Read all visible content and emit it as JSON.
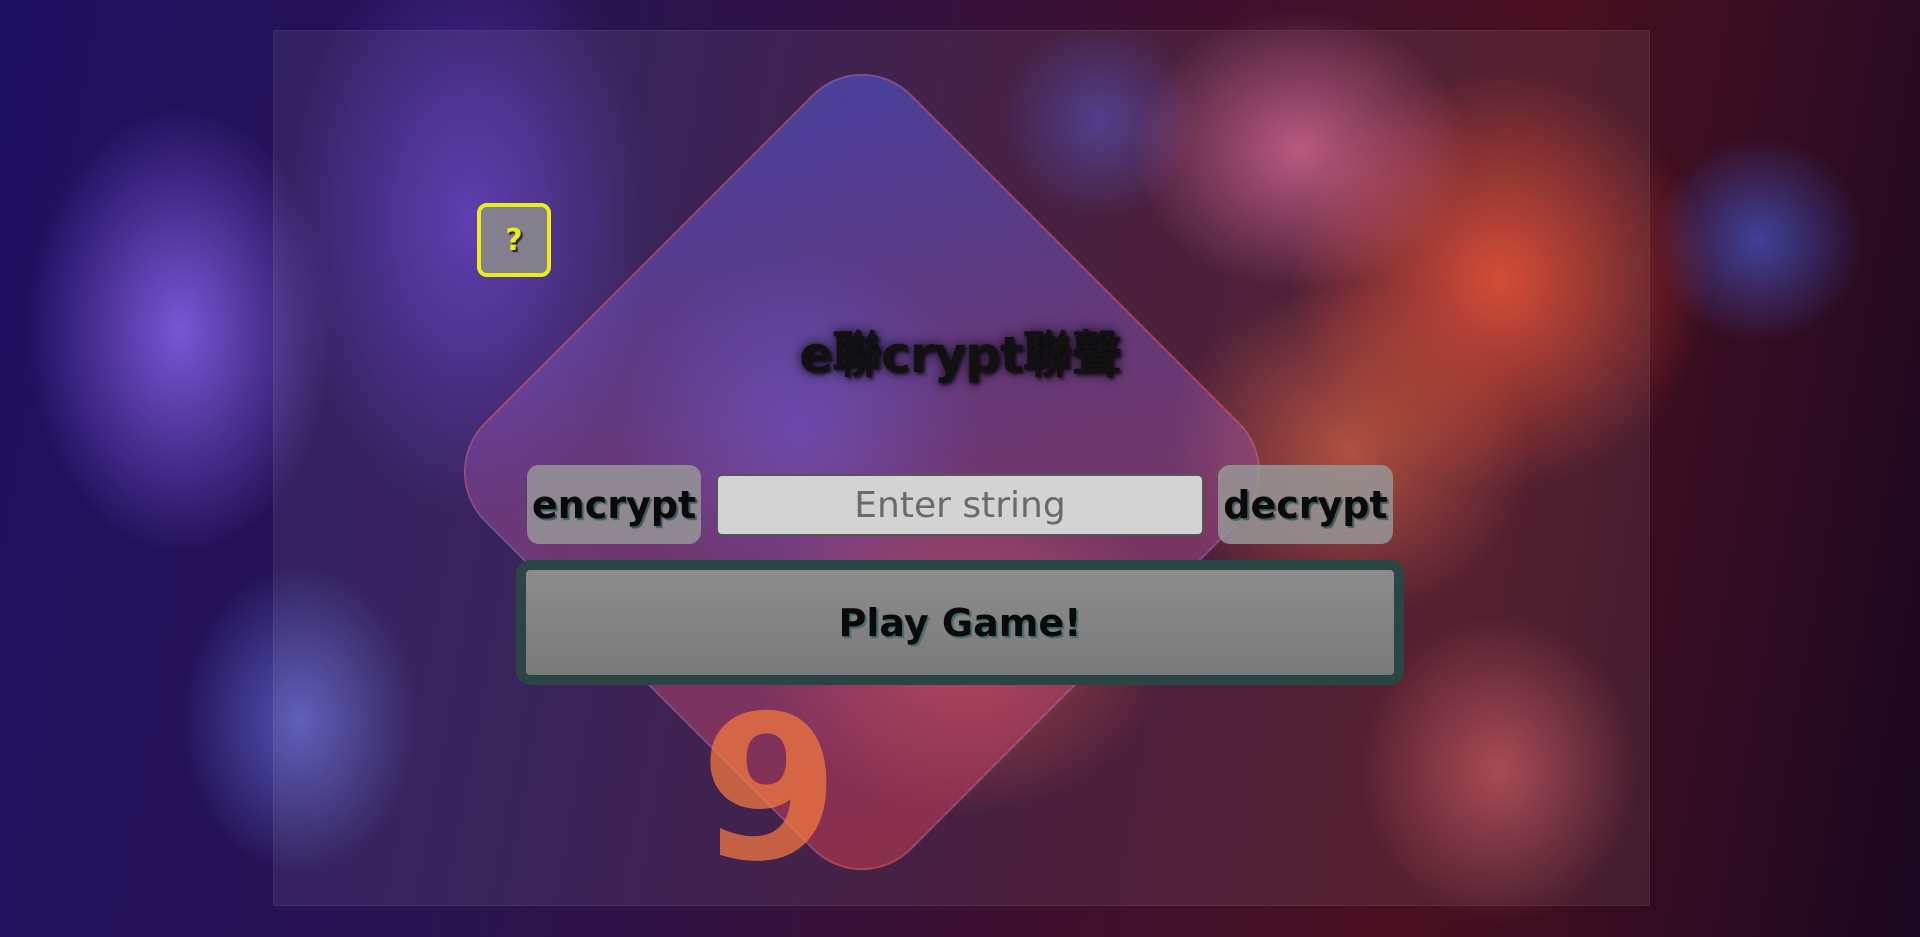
{
  "app": {
    "title": "e聯crypt聯聲"
  },
  "help": {
    "label": "?"
  },
  "controls": {
    "encrypt_label": "encrypt",
    "decrypt_label": "decrypt",
    "input_placeholder": "Enter string",
    "input_value": ""
  },
  "play": {
    "label": "Play Game!"
  },
  "background": {
    "dice_number": "9"
  },
  "colors": {
    "help_accent": "#ecec1a",
    "button_gray": "#969696",
    "play_border": "#2b4444",
    "input_bg": "#d3d3d3"
  }
}
